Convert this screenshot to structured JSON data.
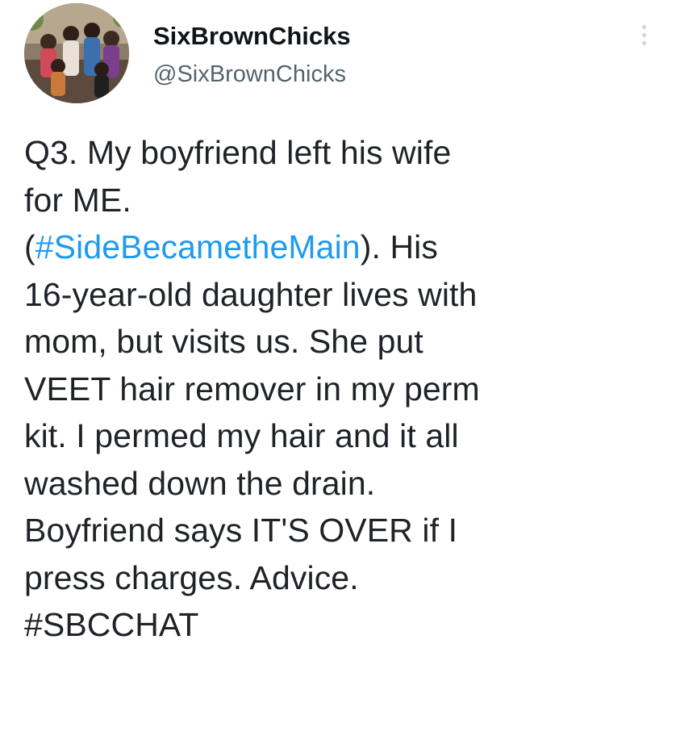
{
  "author": {
    "display_name": "SixBrownChicks",
    "handle": "@SixBrownChicks",
    "avatar_icon": "group-photo-avatar"
  },
  "menu": {
    "icon": "more-options-icon"
  },
  "tweet": {
    "lines": {
      "l1": "Q3. My boyfriend left his wife",
      "l2": "for ME.",
      "l3_open": "(",
      "l3_hashtag": "#SideBecametheMain",
      "l3_close": "). His",
      "l4": "16-year-old daughter lives with",
      "l5": "mom, but visits us. She put",
      "l6": "VEET hair remover in my perm",
      "l7": "kit. I permed my hair and it all",
      "l8": "washed down the drain.",
      "l9": "Boyfriend says IT'S OVER if I",
      "l10": "press charges. Advice.",
      "l11_hashtag": "#SBCCHAT"
    }
  },
  "colors": {
    "link": "#1d9bf0",
    "text": "#1f2328",
    "secondary": "#536471"
  }
}
